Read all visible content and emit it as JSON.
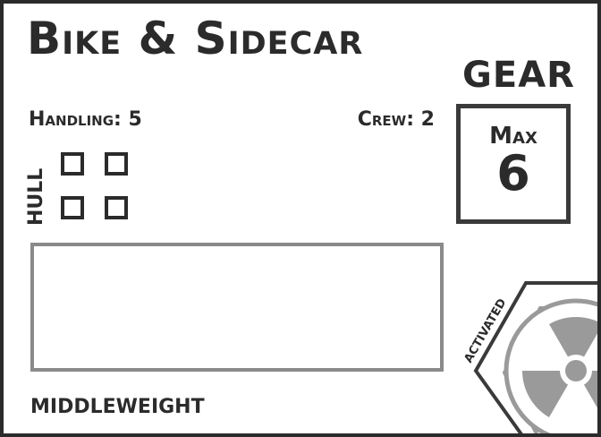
{
  "card": {
    "title": "Bike & Sidecar",
    "gear": {
      "label": "GEAR",
      "max_label": "Max",
      "max_value": "6"
    },
    "handling": "Handling: 5",
    "crew": "Crew: 2",
    "hull": {
      "label": "HULL",
      "boxes": 4
    },
    "weight_class": "MIDDLEWEIGHT",
    "activated_label": "ACTIVATED",
    "colors": {
      "ink": "#2b2b2b",
      "textbox_border": "#8a8a8a",
      "hazard_grey": "#9a9a9a"
    }
  }
}
